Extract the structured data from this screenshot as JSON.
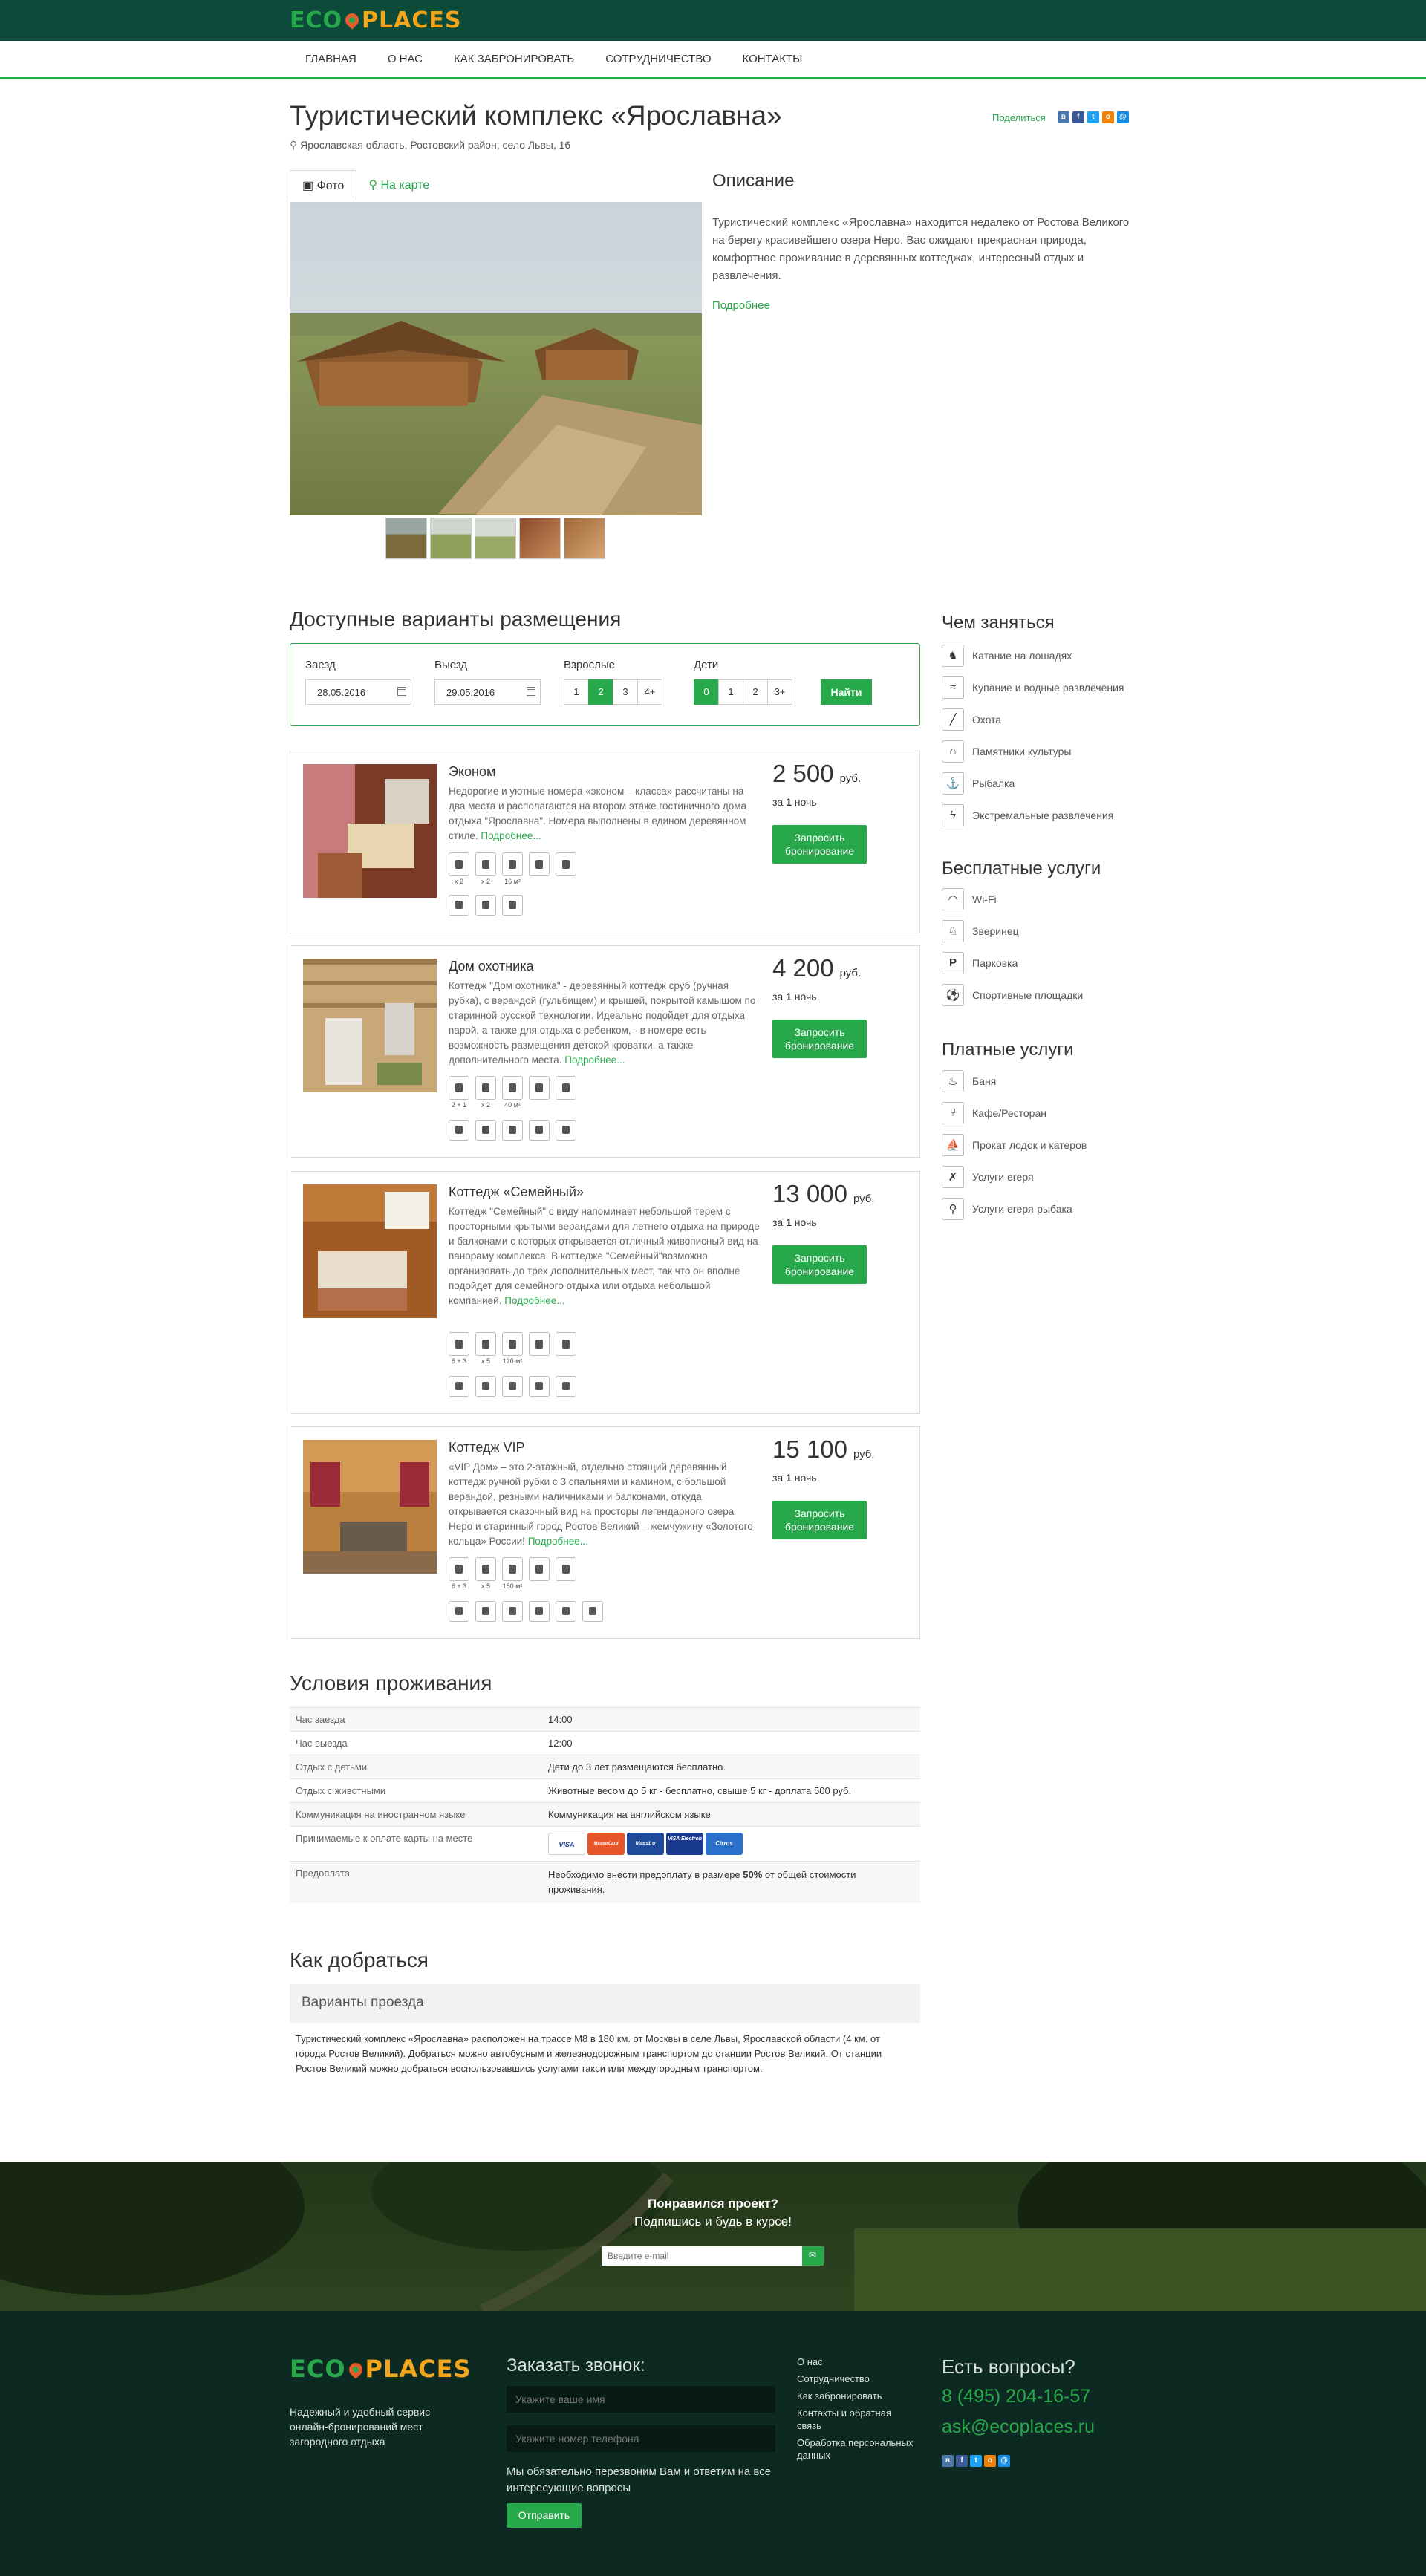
{
  "brand": {
    "eco": "ECO",
    "places": "PLACES"
  },
  "nav": [
    "ГЛАВНАЯ",
    "О НАС",
    "КАК ЗАБРОНИРОВАТЬ",
    "СОТРУДНИЧЕСТВО",
    "КОНТАКТЫ"
  ],
  "hotel": {
    "title": "Туристический комплекс «Ярославна»",
    "address": "Ярославская область, Ростовский район, село Львы, 16",
    "share_label": "Поделиться"
  },
  "tabs": {
    "photo": "Фото",
    "map": "На карте"
  },
  "description": {
    "title": "Описание",
    "text": "Туристический комплекс «Ярославна» находится недалеко от Ростова Великого на берегу красивейшего озера Неро. Вас ожидают прекрасная природа, комфортное проживание в деревянных коттеджах, интересный отдых и развлечения.",
    "more": "Подробнее"
  },
  "availability": {
    "title": "Доступные варианты размещения",
    "checkin_label": "Заезд",
    "checkin_value": "28.05.2016",
    "checkout_label": "Выезд",
    "checkout_value": "29.05.2016",
    "adults_label": "Взрослые",
    "adults_options": [
      "1",
      "2",
      "3",
      "4+"
    ],
    "adults_selected": "2",
    "children_label": "Дети",
    "children_options": [
      "0",
      "1",
      "2",
      "3+"
    ],
    "children_selected": "0",
    "find_button": "Найти"
  },
  "rooms": [
    {
      "name": "Эконом",
      "text": "Недорогие и уютные номера «эконом – класса» рассчитаны на два места и располагаются на втором этаже гостиничного дома отдыха \"Ярославна\". Номера выполнены в едином деревянном стиле.",
      "more": "Подробнее...",
      "price": "2 500",
      "currency": "руб.",
      "per_prefix": "за",
      "per_num": "1",
      "per_suffix": "ночь",
      "book": "Запросить бронирование",
      "caps": [
        "x 2",
        "x 2",
        "16 м²"
      ]
    },
    {
      "name": "Дом охотника",
      "text": "Коттедж \"Дом охотника\" - деревянный коттедж сруб (ручная рубка), с верандой (гульбищем) и крышей, покрытой камышом по старинной русской технологии. Идеально подойдет для отдыха парой, а также для отдыха с ребенком, - в номере есть возможность размещения детской кроватки, а также дополнительного места.",
      "more": "Подробнее...",
      "price": "4 200",
      "currency": "руб.",
      "per_prefix": "за",
      "per_num": "1",
      "per_suffix": "ночь",
      "book": "Запросить бронирование",
      "caps": [
        "2 + 1",
        "x 2",
        "40 м²"
      ]
    },
    {
      "name": "Коттедж «Семейный»",
      "text": "Коттедж \"Семейный\" с виду напоминает небольшой терем с просторными крытыми верандами для летнего отдыха на природе и балконами с которых открывается отличный живописный вид на панораму комплекса. В коттедже \"Семейный\"возможно организовать до трех дополнительных мест, так что он вполне подойдет для семейного отдыха или отдыха небольшой компанией.",
      "more": "Подробнее...",
      "price": "13 000",
      "currency": "руб.",
      "per_prefix": "за",
      "per_num": "1",
      "per_suffix": "ночь",
      "book": "Запросить бронирование",
      "caps": [
        "6 + 3",
        "x 5",
        "120 м²"
      ]
    },
    {
      "name": "Коттедж VIP",
      "text": "«VIP Дом» – это 2-этажный, отдельно стоящий деревянный коттедж ручной рубки с 3 спальнями и камином, с большой верандой, резными наличниками и балконами, откуда открывается сказочный вид на просторы легендарного озера Неро и старинный город Ростов Великий – жемчужину «Золотого кольца» России!",
      "more": "Подробнее...",
      "price": "15 100",
      "currency": "руб.",
      "per_prefix": "за",
      "per_num": "1",
      "per_suffix": "ночь",
      "book": "Запросить бронирование",
      "caps": [
        "6 + 3",
        "x 5",
        "150 м²"
      ]
    }
  ],
  "sidebar": {
    "activities_title": "Чем заняться",
    "activities": [
      "Катание на лошадях",
      "Купание и водные развлечения",
      "Охота",
      "Памятники культуры",
      "Рыбалка",
      "Экстремальные развлечения"
    ],
    "free_title": "Бесплатные услуги",
    "free": [
      "Wi-Fi",
      "Зверинец",
      "Парковка",
      "Спортивные площадки"
    ],
    "paid_title": "Платные услуги",
    "paid": [
      "Баня",
      "Кафе/Ресторан",
      "Прокат лодок и катеров",
      "Услуги егеря",
      "Услуги егеря-рыбака"
    ]
  },
  "conditions": {
    "title": "Условия проживания",
    "rows": [
      {
        "k": "Час заезда",
        "v": "14:00"
      },
      {
        "k": "Час выезда",
        "v": "12:00"
      },
      {
        "k": "Отдых с детьми",
        "v": "Дети до 3 лет размещаются бесплатно."
      },
      {
        "k": "Отдых с животными",
        "v": "Животные весом до 5 кг - бесплатно, свыше 5 кг - доплата 500 руб."
      },
      {
        "k": "Коммуникация на иностранном языке",
        "v": "Коммуникация на английском языке"
      },
      {
        "k": "Принимаемые к оплате карты на месте",
        "v": ""
      },
      {
        "k": "Предоплата",
        "v": ""
      }
    ],
    "cards": [
      "VISA",
      "MasterCard",
      "Maestro",
      "VISA Electron",
      "Cirrus"
    ],
    "prepay_a": "Необходимо внести предоплату в размере ",
    "prepay_b": "50%",
    "prepay_c": " от общей стоимости проживания."
  },
  "route": {
    "title": "Как добраться",
    "box": "Варианты проезда",
    "text": "Туристический комплекс «Ярославна» расположен на трассе М8 в 180 км. от Москвы в селе Львы, Ярославской области (4 км. от города Ростов Великий). Добраться можно автобусным и железнодорожным транспортом до станции Ростов Великий. От станции Ростов Великий можно добраться воспользовавшись услугами такси или междугородным транспортом."
  },
  "subscribe": {
    "title": "Понравился проект?",
    "subtitle": "Подпишись и будь в курсе!",
    "placeholder": "Введите e-mail"
  },
  "footer": {
    "tagline": "Надежный и удобный сервис онлайн-бронирований мест загородного отдыха",
    "call_title": "Заказать звонок:",
    "name_placeholder": "Укажите ваше имя",
    "phone_placeholder": "Укажите номер телефона",
    "note": "Мы обязательно перезвоним Вам и ответим на все интересующие вопросы",
    "send": "Отправить",
    "links": [
      "О нас",
      "Сотрудничество",
      "Как забронировать",
      "Контакты и обратная связь",
      "Обработка персональных данных"
    ],
    "questions": "Есть вопросы?",
    "phone": "8 (495) 204-16-57",
    "email": "ask@ecoplaces.ru"
  }
}
